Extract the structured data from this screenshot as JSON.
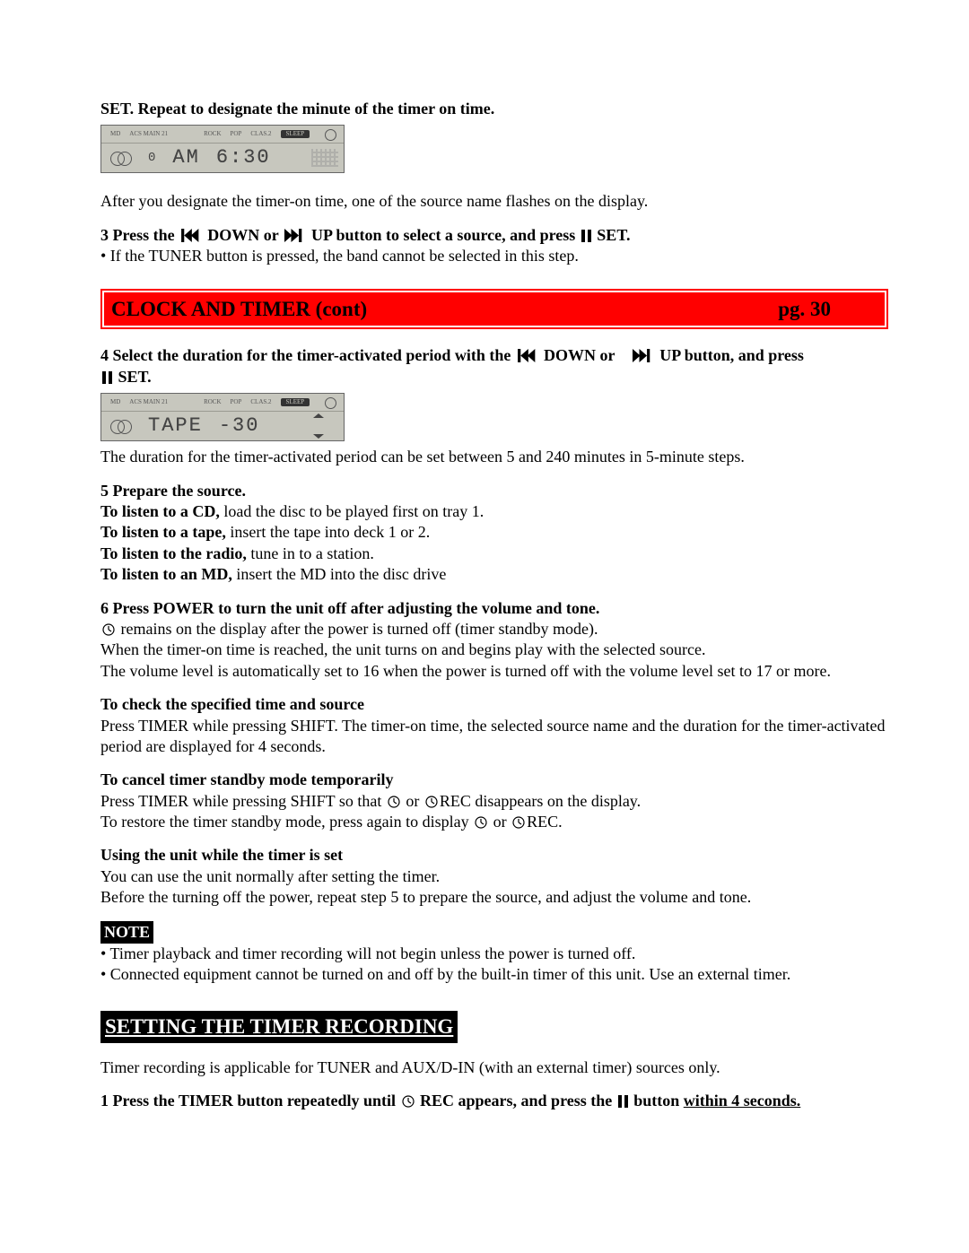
{
  "intro": {
    "set_repeat": "SET.  Repeat to designate the minute of the timer on time.",
    "after_designate": "After you designate the timer-on time, one of the source name flashes on the display."
  },
  "lcd1": {
    "top_labels": [
      "MD",
      "ACS MAIN 21",
      "ROCK",
      "POP",
      "CLAS.2"
    ],
    "top_badge": "SLEEP",
    "left": "0",
    "mid": "AM",
    "right": "6:30"
  },
  "step3": {
    "prefix": "3  Press the",
    "mid1": "DOWN or",
    "mid2": "UP button to select a source, and press",
    "end": "SET.",
    "note": "• If the TUNER button is pressed, the band cannot be selected in this step."
  },
  "section": {
    "title": "CLOCK AND TIMER (cont)",
    "page": "pg. 30"
  },
  "step4": {
    "prefix": "4  Select the duration for the timer-activated period with the",
    "mid1": "DOWN or",
    "mid2": "UP button, and press",
    "end": "SET.",
    "note": "The duration for the timer-activated period can be set between 5 and 240 minutes in 5-minute steps."
  },
  "lcd2": {
    "top_labels": [
      "MD",
      "ACS MAIN 21",
      "ROCK",
      "POP",
      "CLAS.2"
    ],
    "top_badge": "SLEEP",
    "mid": "TAPE",
    "right": "-30"
  },
  "step5": {
    "heading": "5  Prepare the source.",
    "cd_b": "To listen to a CD,",
    "cd_t": " load the disc to be played first on tray 1.",
    "tape_b": "To listen to a tape,",
    "tape_t": " insert the tape into deck 1 or 2.",
    "radio_b": "To listen to the radio,",
    "radio_t": " tune in to a station.",
    "md_b": "To listen to an MD,",
    "md_t": " insert the MD into the disc drive"
  },
  "step6": {
    "heading": "6  Press POWER to turn the unit off after adjusting the volume and tone.",
    "line1a": " remains on the display after the power is turned off (timer standby mode).",
    "line2": "When the timer-on time is reached, the unit turns on and begins play with the selected source.",
    "line3": "The volume level is automatically set to 16 when the power is turned off with the volume level set to 17 or more."
  },
  "check": {
    "heading": "To check the specified time and source",
    "body": "Press TIMER while pressing SHIFT.  The timer-on time, the selected source name and the duration for the timer-activated period are displayed for 4 seconds."
  },
  "cancel": {
    "heading": "To cancel timer standby mode temporarily",
    "l1a": "Press TIMER while pressing SHIFT so that ",
    "l1b": " or ",
    "l1c": "REC disappears on the display.",
    "l2a": "To restore the timer standby mode, press again to display ",
    "l2b": " or ",
    "l2c": "REC."
  },
  "using": {
    "heading": "Using the unit while the timer is set",
    "line1": "You can use the unit normally after setting the timer.",
    "line2": "Before the turning off the power, repeat step 5 to prepare the source, and adjust the volume and tone."
  },
  "note": {
    "label": "NOTE",
    "b1": "• Timer playback and timer recording will not begin unless the power is turned off.",
    "b2": "• Connected equipment cannot be turned on and off by the built-in timer of this unit.  Use an external timer."
  },
  "subsection": {
    "title": "SETTING THE TIMER RECORDING"
  },
  "sub_intro": "Timer recording is applicable for TUNER and AUX/D-IN (with an external timer) sources only.",
  "sub_step1": {
    "a": "1 Press the TIMER button repeatedly until ",
    "b": " REC appears, and press the ",
    "c": " button ",
    "d": "within 4 seconds."
  },
  "icons": {
    "rew": "skip-back-icon",
    "fwd": "skip-forward-icon",
    "pause": "pause-icon",
    "clock": "clock-icon"
  }
}
